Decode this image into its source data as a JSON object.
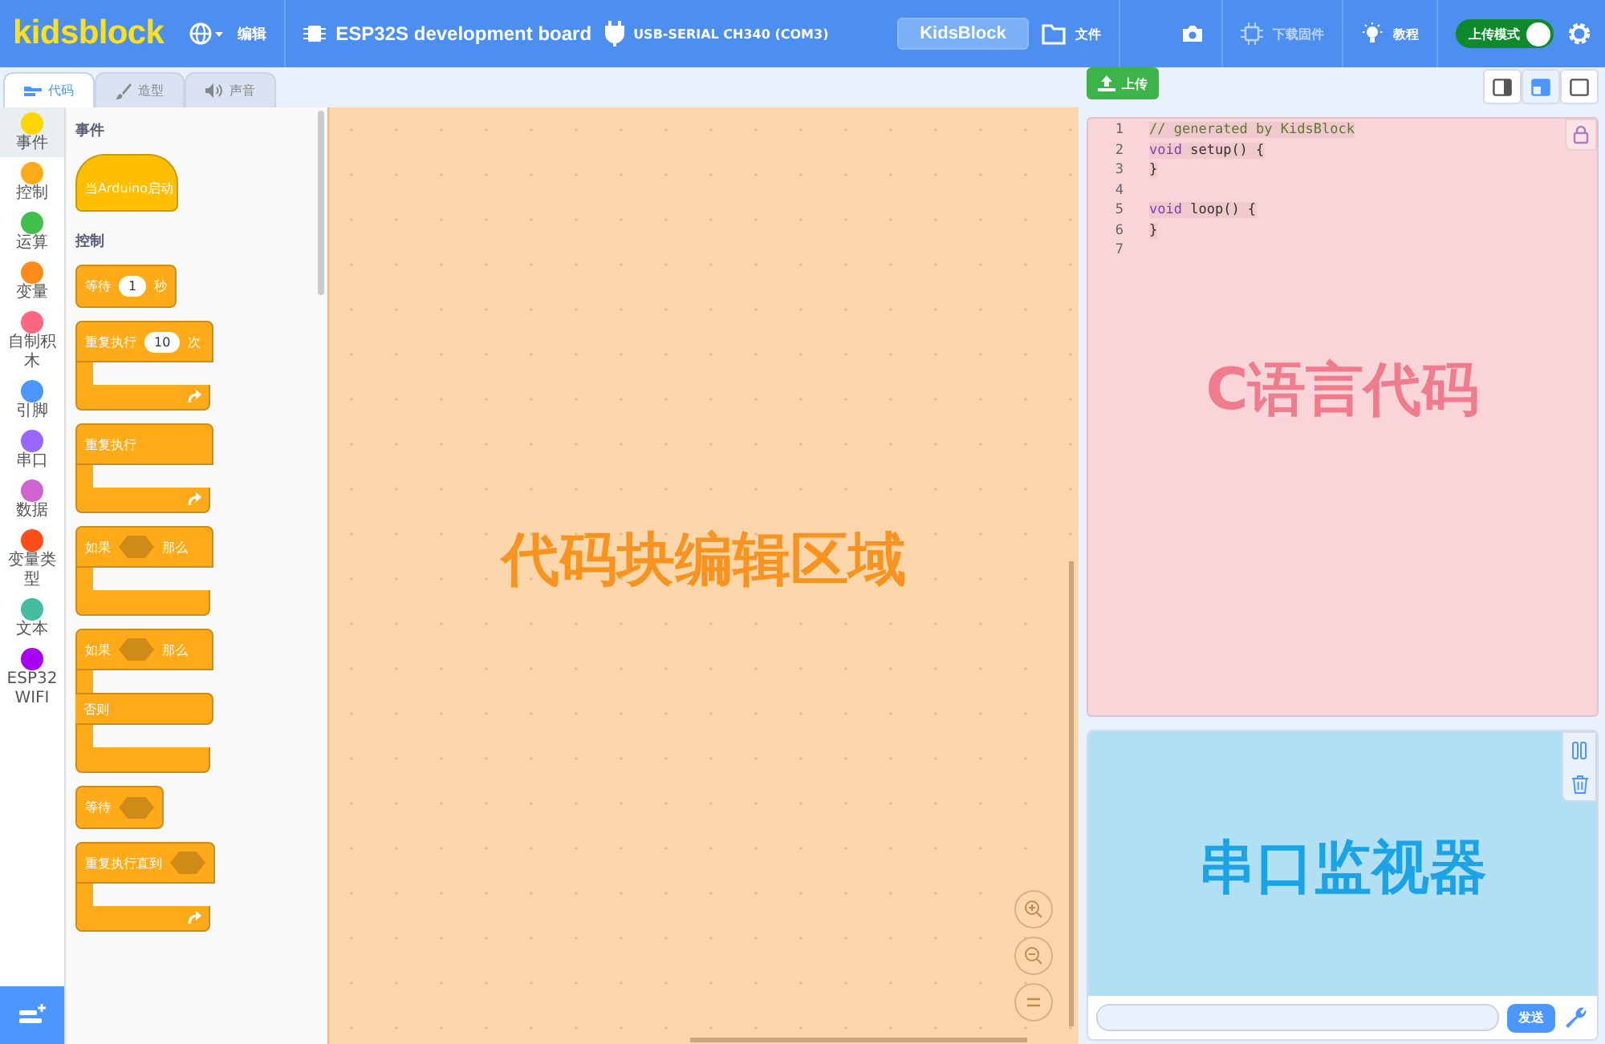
{
  "menubar": {
    "logo": "kidsblock",
    "edit_menu": "编辑",
    "board": "ESP32S development board",
    "port": "USB-SERIAL CH340 (COM3)",
    "project_name": "KidsBlock",
    "file_menu": "文件",
    "firmware": {
      "label": "下载固件",
      "disabled": true
    },
    "tutorial": "教程",
    "upload_mode": {
      "label": "上传模式",
      "on": true
    }
  },
  "tabs": [
    {
      "label": "代码",
      "selected": true
    },
    {
      "label": "造型",
      "selected": false
    },
    {
      "label": "声音",
      "selected": false
    }
  ],
  "categories": [
    {
      "label": "事件",
      "color": "#ffd500",
      "selected": true
    },
    {
      "label": "控制",
      "color": "#ffab19",
      "selected": false
    },
    {
      "label": "运算",
      "color": "#40bf4a",
      "selected": false
    },
    {
      "label": "变量",
      "color": "#ff8c1a",
      "selected": false
    },
    {
      "label": "自制积木",
      "color": "#ff6680",
      "selected": false
    },
    {
      "label": "引脚",
      "color": "#4c97ff",
      "selected": false
    },
    {
      "label": "串口",
      "color": "#9966ff",
      "selected": false
    },
    {
      "label": "数据",
      "color": "#cf63cf",
      "selected": false
    },
    {
      "label": "变量类型",
      "color": "#ff4d1a",
      "selected": false
    },
    {
      "label": "文本",
      "color": "#45bd9f",
      "selected": false
    },
    {
      "label": "ESP32 WIFI",
      "color": "#a800f0",
      "selected": false
    }
  ],
  "palette": [
    {
      "heading": "事件",
      "blocks": [
        {
          "kind": "hat",
          "parts": [
            {
              "kind": "text",
              "text": "当Arduino启动"
            }
          ]
        }
      ]
    },
    {
      "heading": "控制",
      "blocks": [
        {
          "kind": "stack",
          "parts": [
            {
              "kind": "text",
              "text": "等待"
            },
            {
              "kind": "number",
              "text": "1"
            },
            {
              "kind": "text",
              "text": "秒"
            }
          ]
        },
        {
          "kind": "c",
          "loop": true,
          "parts": [
            {
              "kind": "text",
              "text": "重复执行"
            },
            {
              "kind": "number",
              "text": "10"
            },
            {
              "kind": "text",
              "text": "次"
            }
          ]
        },
        {
          "kind": "c",
          "loop": true,
          "parts": [
            {
              "kind": "text",
              "text": "重复执行"
            }
          ]
        },
        {
          "kind": "c",
          "loop": false,
          "parts": [
            {
              "kind": "text",
              "text": "如果"
            },
            {
              "kind": "slot"
            },
            {
              "kind": "text",
              "text": "那么"
            }
          ]
        },
        {
          "kind": "c-else",
          "loop": false,
          "else_label": "否则",
          "parts": [
            {
              "kind": "text",
              "text": "如果"
            },
            {
              "kind": "slot"
            },
            {
              "kind": "text",
              "text": "那么"
            }
          ]
        },
        {
          "kind": "stack",
          "parts": [
            {
              "kind": "text",
              "text": "等待"
            },
            {
              "kind": "slot"
            }
          ]
        },
        {
          "kind": "c",
          "loop": true,
          "parts": [
            {
              "kind": "text",
              "text": "重复执行直到"
            },
            {
              "kind": "slot"
            }
          ]
        }
      ]
    }
  ],
  "canvas": {
    "caption": "代码块编辑区域"
  },
  "upload_button": "上传",
  "layout_buttons": [
    {
      "selected": false
    },
    {
      "selected": true
    },
    {
      "selected": false
    }
  ],
  "code_editor": {
    "caption": "C语言代码",
    "lines": [
      {
        "number": "1",
        "tokens": [
          {
            "kind": "comment",
            "text": "// generated by KidsBlock"
          }
        ]
      },
      {
        "number": "2",
        "tokens": [
          {
            "kind": "keyword",
            "text": "void"
          },
          {
            "kind": "plain",
            "text": " setup() {"
          }
        ]
      },
      {
        "number": "3",
        "tokens": [
          {
            "kind": "plain",
            "text": "}"
          }
        ]
      },
      {
        "number": "4"
      },
      {
        "number": "5",
        "tokens": [
          {
            "kind": "keyword",
            "text": "void"
          },
          {
            "kind": "plain",
            "text": " loop() {"
          }
        ]
      },
      {
        "number": "6",
        "tokens": [
          {
            "kind": "plain",
            "text": "}"
          }
        ]
      },
      {
        "number": "7"
      }
    ]
  },
  "serial_monitor": {
    "caption": "串口监视器",
    "send_button": "发送"
  }
}
